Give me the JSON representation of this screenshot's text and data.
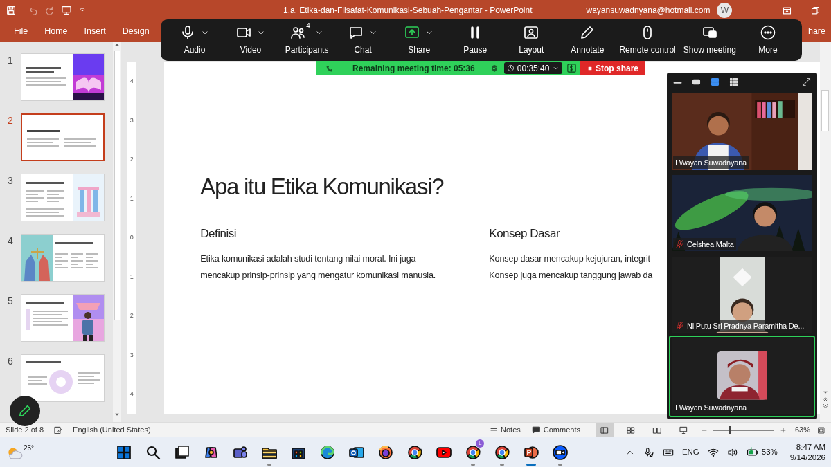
{
  "title_bar": {
    "document_title": "1.a.  Etika-dan-Filsafat-Komunikasi-Sebuah-Pengantar  -  PowerPoint",
    "account": "wayansuwadnyana@hotmail.com",
    "avatar_initial": "W"
  },
  "ribbon_tabs": [
    {
      "label": "File",
      "selected": false
    },
    {
      "label": "Home",
      "selected": false
    },
    {
      "label": "Insert",
      "selected": false
    },
    {
      "label": "Design",
      "selected": false
    }
  ],
  "share_button": "hare",
  "zoom_toolbar": {
    "buttons": [
      {
        "label": "Audio",
        "kind": "mic",
        "caret": true
      },
      {
        "label": "Video",
        "kind": "camera",
        "caret": true
      },
      {
        "label": "Participants",
        "kind": "people",
        "caret": true,
        "count": "4"
      },
      {
        "label": "Chat",
        "kind": "chat",
        "caret": true
      },
      {
        "label": "Share",
        "kind": "share",
        "caret": true
      },
      {
        "label": "Pause",
        "kind": "pause",
        "caret": false
      },
      {
        "label": "Layout",
        "kind": "layout",
        "caret": false
      },
      {
        "label": "Annotate",
        "kind": "pencil",
        "caret": false
      },
      {
        "label": "Remote control",
        "kind": "mouse",
        "caret": false
      },
      {
        "label": "Show meeting",
        "kind": "window",
        "caret": false
      },
      {
        "label": "More",
        "kind": "more",
        "caret": false
      }
    ]
  },
  "meeting_bar": {
    "remaining": "Remaining meeting time: 05:36",
    "timer": "00:35:40",
    "stop_share": "Stop share"
  },
  "thumbnails": [
    {
      "number": "1",
      "selected": false,
      "kind": "cover"
    },
    {
      "number": "2",
      "selected": true,
      "kind": "text"
    },
    {
      "number": "3",
      "selected": false,
      "kind": "pillars"
    },
    {
      "number": "4",
      "selected": false,
      "kind": "hands"
    },
    {
      "number": "5",
      "selected": false,
      "kind": "person"
    },
    {
      "number": "6",
      "selected": false,
      "kind": "diagram"
    }
  ],
  "ruler_marks": [
    "4",
    "3",
    "2",
    "1",
    "0",
    "1",
    "2",
    "3",
    "4"
  ],
  "slide": {
    "title": "Apa itu Etika Komunikasi?",
    "columns": [
      {
        "heading": "Definisi",
        "lines": [
          "Etika komunikasi adalah studi tentang nilai moral. Ini juga",
          "mencakup prinsip-prinsip yang mengatur komunikasi manusia."
        ]
      },
      {
        "heading": "Konsep Dasar",
        "lines": [
          "Konsep dasar mencakup kejujuran, integrit",
          "Konsep juga mencakup tanggung jawab da"
        ]
      }
    ]
  },
  "video_panel": {
    "view_modes": [
      {
        "kind": "minimize",
        "selected": false
      },
      {
        "kind": "single",
        "selected": false
      },
      {
        "kind": "strip",
        "selected": true
      },
      {
        "kind": "grid",
        "selected": false
      }
    ],
    "tiles": [
      {
        "name": "I Wayan Suwadnyana",
        "muted": false,
        "speaking": false,
        "kind": "room"
      },
      {
        "name": "Celshea Malta",
        "muted": true,
        "speaking": false,
        "kind": "aurora"
      },
      {
        "name": "Ni Putu Sri Pradnya Paramitha De...",
        "muted": true,
        "speaking": false,
        "kind": "ceiling"
      },
      {
        "name": "I Wayan Suwadnyana",
        "muted": false,
        "speaking": true,
        "kind": "portrait"
      }
    ]
  },
  "status_bar": {
    "slide": "Slide 2 of 8",
    "language": "English (United States)",
    "notes": "Notes",
    "comments": "Comments",
    "views": [
      {
        "kind": "normal",
        "selected": true
      },
      {
        "kind": "sorter",
        "selected": false
      },
      {
        "kind": "reading",
        "selected": false
      },
      {
        "kind": "show",
        "selected": false
      }
    ],
    "zoom": {
      "level": 0.25,
      "reading": "63%"
    }
  },
  "taskbar": {
    "weather": "25°",
    "apps": [
      {
        "kind": "start",
        "running": false
      },
      {
        "kind": "search",
        "running": false
      },
      {
        "kind": "taskview",
        "running": false
      },
      {
        "kind": "copilot",
        "running": false
      },
      {
        "kind": "teams",
        "running": false
      },
      {
        "kind": "folder",
        "running": true
      },
      {
        "kind": "store",
        "running": false
      },
      {
        "kind": "edge",
        "running": false
      },
      {
        "kind": "outlook",
        "running": false
      },
      {
        "kind": "firefox",
        "running": false
      },
      {
        "kind": "chrome",
        "running": false
      },
      {
        "kind": "youtube",
        "running": false
      },
      {
        "kind": "chrome",
        "running": true,
        "badge": "L"
      },
      {
        "kind": "chrome",
        "running": true
      },
      {
        "kind": "powerpoint",
        "running": true
      },
      {
        "kind": "zoom",
        "running": true
      }
    ],
    "language": "ENG",
    "battery": "53%",
    "time": "8:47 AM",
    "date": "9/14/2026"
  }
}
